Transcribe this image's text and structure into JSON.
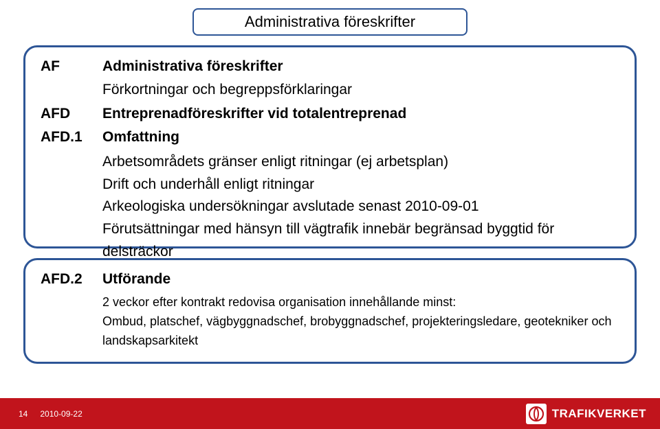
{
  "slide": {
    "title": "Administrativa föreskrifter",
    "box1": {
      "rows": [
        {
          "code": "AF",
          "label": "Administrativa föreskrifter",
          "bold": true
        },
        {
          "code": "",
          "label": "Förkortningar och begreppsförklaringar",
          "bold": false
        },
        {
          "code": "AFD",
          "label": "Entreprenadföreskrifter vid totalentreprenad",
          "bold": true
        },
        {
          "code": "AFD.1",
          "label": "Omfattning",
          "bold": true
        }
      ],
      "subs": [
        "Arbetsområdets gränser enligt ritningar (ej arbetsplan)",
        "Drift och underhåll enligt ritningar",
        "Arkeologiska undersökningar avslutade senast 2010-09-01",
        "Förutsättningar med hänsyn till vägtrafik innebär begränsad byggtid för delsträckor"
      ]
    },
    "box2": {
      "rows": [
        {
          "code": "AFD.2",
          "label": "Utförande",
          "bold": true
        }
      ],
      "subs": [
        "2 veckor efter kontrakt redovisa organisation innehållande minst:",
        "Ombud, platschef, vägbyggnadschef, brobyggnadschef, projekteringsledare, geotekniker och landskapsarkitekt"
      ]
    }
  },
  "footer": {
    "page": "14",
    "date": "2010-09-22",
    "brand": "TRAFIKVERKET",
    "logo_name": "trafikverket-logo"
  }
}
